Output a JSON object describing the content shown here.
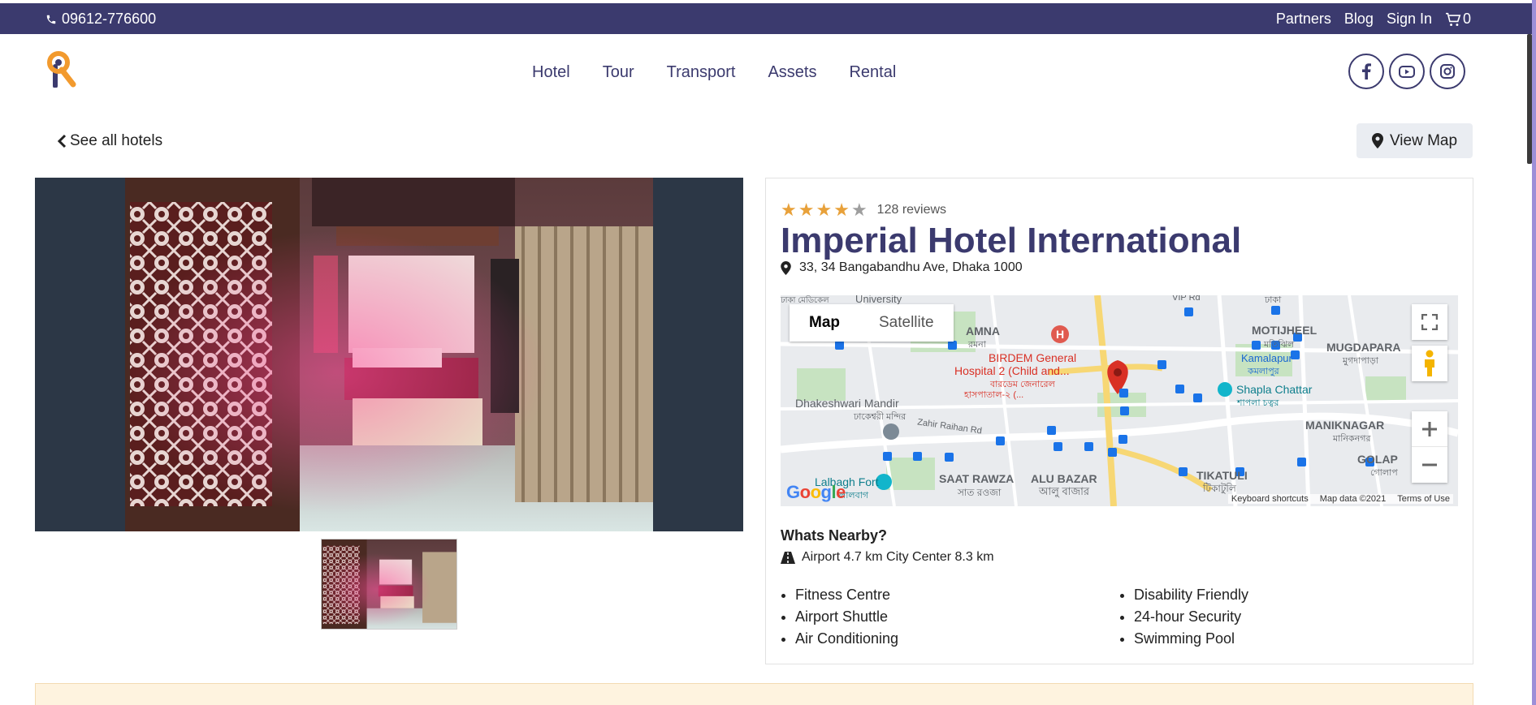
{
  "topbar": {
    "phone": "09612-776600",
    "links": [
      "Partners",
      "Blog",
      "Sign In"
    ],
    "cart_count": "0"
  },
  "nav": {
    "items": [
      "Hotel",
      "Tour",
      "Transport",
      "Assets",
      "Rental"
    ]
  },
  "social": {
    "icons": [
      "facebook-icon",
      "youtube-icon",
      "instagram-icon"
    ]
  },
  "back_link": "See all hotels",
  "view_map": "View Map",
  "hotel": {
    "rating": 4,
    "rating_max": 5,
    "reviews": "128 reviews",
    "name": "Imperial Hotel International",
    "address": "33, 34 Bangabandhu Ave, Dhaka 1000"
  },
  "map": {
    "tabs": [
      "Map",
      "Satellite"
    ],
    "labels": {
      "motijheel": "MOTIJHEEL",
      "motijheel_bn": "মতিঝিল",
      "mugdapara": "MUGDAPARA",
      "mugdapara_bn": "মুগদাপাড়া",
      "kamalapur": "Kamalapur",
      "kamalapur_bn": "কমলাপুর",
      "shapla": "Shapla Chattar",
      "shapla_bn": "শাপলা চত্বর",
      "birdem_1": "BIRDEM General",
      "birdem_2": "Hospital 2 (Child and...",
      "birdem_bn_1": "বারডেম জেনারেল",
      "birdem_bn_2": "হাসপাতাল-২ (...",
      "ramna": "AMNA",
      "ramna_bn": "রমনা",
      "dhakeshwari": "Dhakeshwari Mandir",
      "dhakeshwari_bn": "ঢাকেশ্বরী মন্দির",
      "zahir": "Zahir Raihan Rd",
      "maniknagar": "MANIKNAGAR",
      "maniknagar_bn": "মানিকনগর",
      "golap": "GOLAP",
      "golap_bn": "গোলাপ",
      "tikatuli": "TIKATULI",
      "tikatuli_bn": "টিকাটুলি",
      "lalbagh": "Lalbagh Fort",
      "lalbagh_bn": "লালবাগ",
      "saat": "SAAT RAWZA",
      "saat_bn": "সাত রওজা",
      "alu": "ALU BAZAR",
      "alu_bn": "আলু বাজার",
      "university": "University",
      "vip": "VIP Rd",
      "dhaka_bn": "ঢাকা",
      "dhaka_med_bn": "ঢাকা মেডিকেল"
    },
    "footer": [
      "Keyboard shortcuts",
      "Map data ©2021",
      "Terms of Use"
    ],
    "brand": "Google"
  },
  "nearby": {
    "title": "Whats Nearby?",
    "info": "Airport 4.7 km City Center 8.3 km"
  },
  "amenities": {
    "left": [
      "Fitness Centre",
      "Airport Shuttle",
      "Air Conditioning"
    ],
    "right": [
      "Disability Friendly",
      "24-hour Security",
      "Swimming Pool"
    ]
  },
  "colors": {
    "brand": "#3b3a6e",
    "star": "#e8a13a",
    "banner": "#fef3df"
  }
}
